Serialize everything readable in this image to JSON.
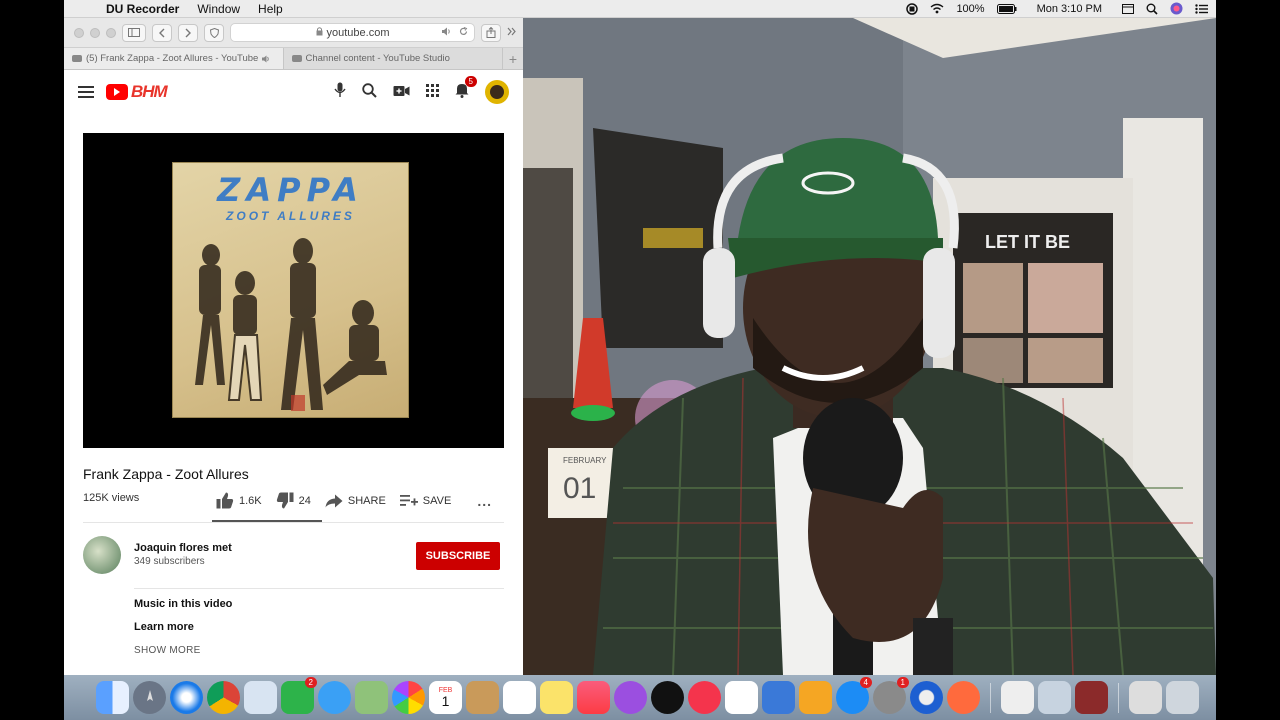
{
  "menubar": {
    "app_name": "DU Recorder",
    "menus": [
      "Window",
      "Help"
    ],
    "battery": "100%",
    "clock": "Mon 3:10 PM"
  },
  "safari": {
    "url": "youtube.com",
    "tabs": [
      {
        "label": "(5) Frank Zappa - Zoot Allures - YouTube"
      },
      {
        "label": "Channel content - YouTube Studio"
      }
    ]
  },
  "youtube": {
    "logo_text": "BHM",
    "notification_count": "5",
    "video": {
      "album_title": "ZAPPA",
      "album_subtitle": "ZOOT ALLURES",
      "title": "Frank Zappa - Zoot Allures",
      "views": "125K views",
      "likes": "1.6K",
      "dislikes": "24",
      "share_label": "SHARE",
      "save_label": "SAVE",
      "more_label": "..."
    },
    "channel": {
      "name": "Joaquin flores met",
      "subscribers": "349 subscribers",
      "subscribe_label": "SUBSCRIBE"
    },
    "description": {
      "music_heading": "Music in this video",
      "learn_more": "Learn more",
      "show_more": "SHOW MORE"
    }
  },
  "webcam": {
    "poster_text": "LET IT BE",
    "calendar_month": "FEBRUARY",
    "calendar_day": "01"
  },
  "dock": {
    "facetime_badge": "2",
    "appstore_badge": "4",
    "prefs_badge": "1",
    "calendar_month": "FEB",
    "calendar_day": "1"
  },
  "colors": {
    "yt_red": "#cc0000",
    "menubar_bg": "#ececec",
    "dock_bg": "#8a9bb0"
  }
}
